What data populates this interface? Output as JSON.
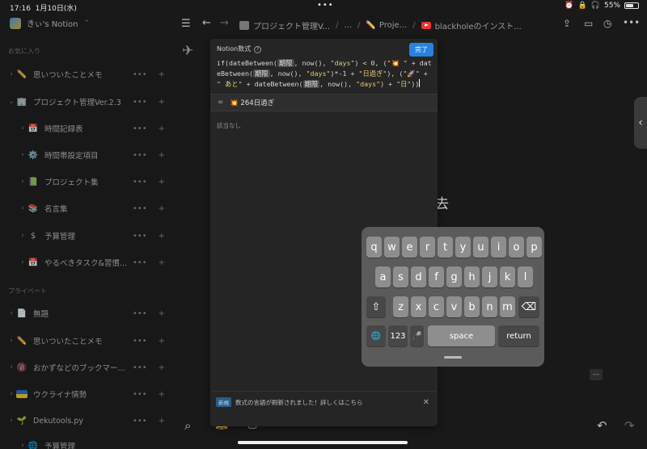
{
  "status": {
    "time": "17:16",
    "date": "1月10日(水)",
    "battery": "55%",
    "battery_level": 0.55
  },
  "sidebar": {
    "workspace": "きぃ's Notion",
    "favorites_label": "お気に入り",
    "private_label": "プライベート",
    "favorites": [
      {
        "label": "思いついたことメモ",
        "icon": "pencil-icon"
      },
      {
        "label": "プロジェクト管理Ver.2.3",
        "icon": "building-icon"
      },
      {
        "label": "時間記録表",
        "icon": "calendar-icon"
      },
      {
        "label": "時間帯設定項目",
        "icon": "gear-icon"
      },
      {
        "label": "プロジェクト集",
        "icon": "notebook-icon"
      },
      {
        "label": "名言集",
        "icon": "book-icon"
      },
      {
        "label": "予算管理",
        "icon": "dollar-icon"
      },
      {
        "label": "やるべきタスク&習慣...",
        "icon": "calendar-icon"
      }
    ],
    "private": [
      {
        "label": "無題",
        "icon": "page-icon"
      },
      {
        "label": "思いついたことメモ",
        "icon": "pencil-icon"
      },
      {
        "label": "おかずなどのブックマー...",
        "icon": "18-icon"
      },
      {
        "label": "ウクライナ情勢",
        "icon": "flag-icon"
      },
      {
        "label": "Dekutools.py",
        "icon": "plant-icon"
      },
      {
        "label": "予算管理",
        "icon": "globe-icon"
      }
    ]
  },
  "topnav": {
    "crumbs": [
      "プロジェクト管理V...",
      "...",
      "Proje...",
      "blackholeのインスト..."
    ]
  },
  "page": {
    "title_fragment": "去"
  },
  "editor": {
    "title": "Notion数式",
    "done": "完了",
    "formula": {
      "p1": "if(dateBetween(",
      "tok1": "期限",
      "p2": ", now(), ",
      "s1": "\"days\"",
      "p3": ") < 0, (",
      "s2": "\"💥 \"",
      "p4": " + dateBetween(",
      "tok2": "期限",
      "p5": ", now(), ",
      "s3": "\"days\"",
      "p6": ")*-1 + ",
      "s4": "\"日過ぎ\"",
      "p7": "), (",
      "s5": "\"🚀\"",
      "p8": " + ",
      "s6": "\" あと\"",
      "p9": " + dateBetween(",
      "tok3": "期限",
      "p10": ", now(), ",
      "s7": "\"days\"",
      "p11": ") + ",
      "s8": "\"日\"",
      "p12": "))"
    },
    "result": "💥 264日過ぎ",
    "empty": "該当なし",
    "notice_badge": "新規",
    "notice": "数式の言語が刷新されました！詳しくはこちら"
  },
  "keyboard": {
    "row1": [
      "q",
      "w",
      "e",
      "r",
      "t",
      "y",
      "u",
      "i",
      "o",
      "p"
    ],
    "row2": [
      "a",
      "s",
      "d",
      "f",
      "g",
      "h",
      "j",
      "k",
      "l"
    ],
    "row3": [
      "z",
      "x",
      "c",
      "v",
      "b",
      "n",
      "m"
    ],
    "num": "123",
    "space": "space",
    "return": "return"
  }
}
